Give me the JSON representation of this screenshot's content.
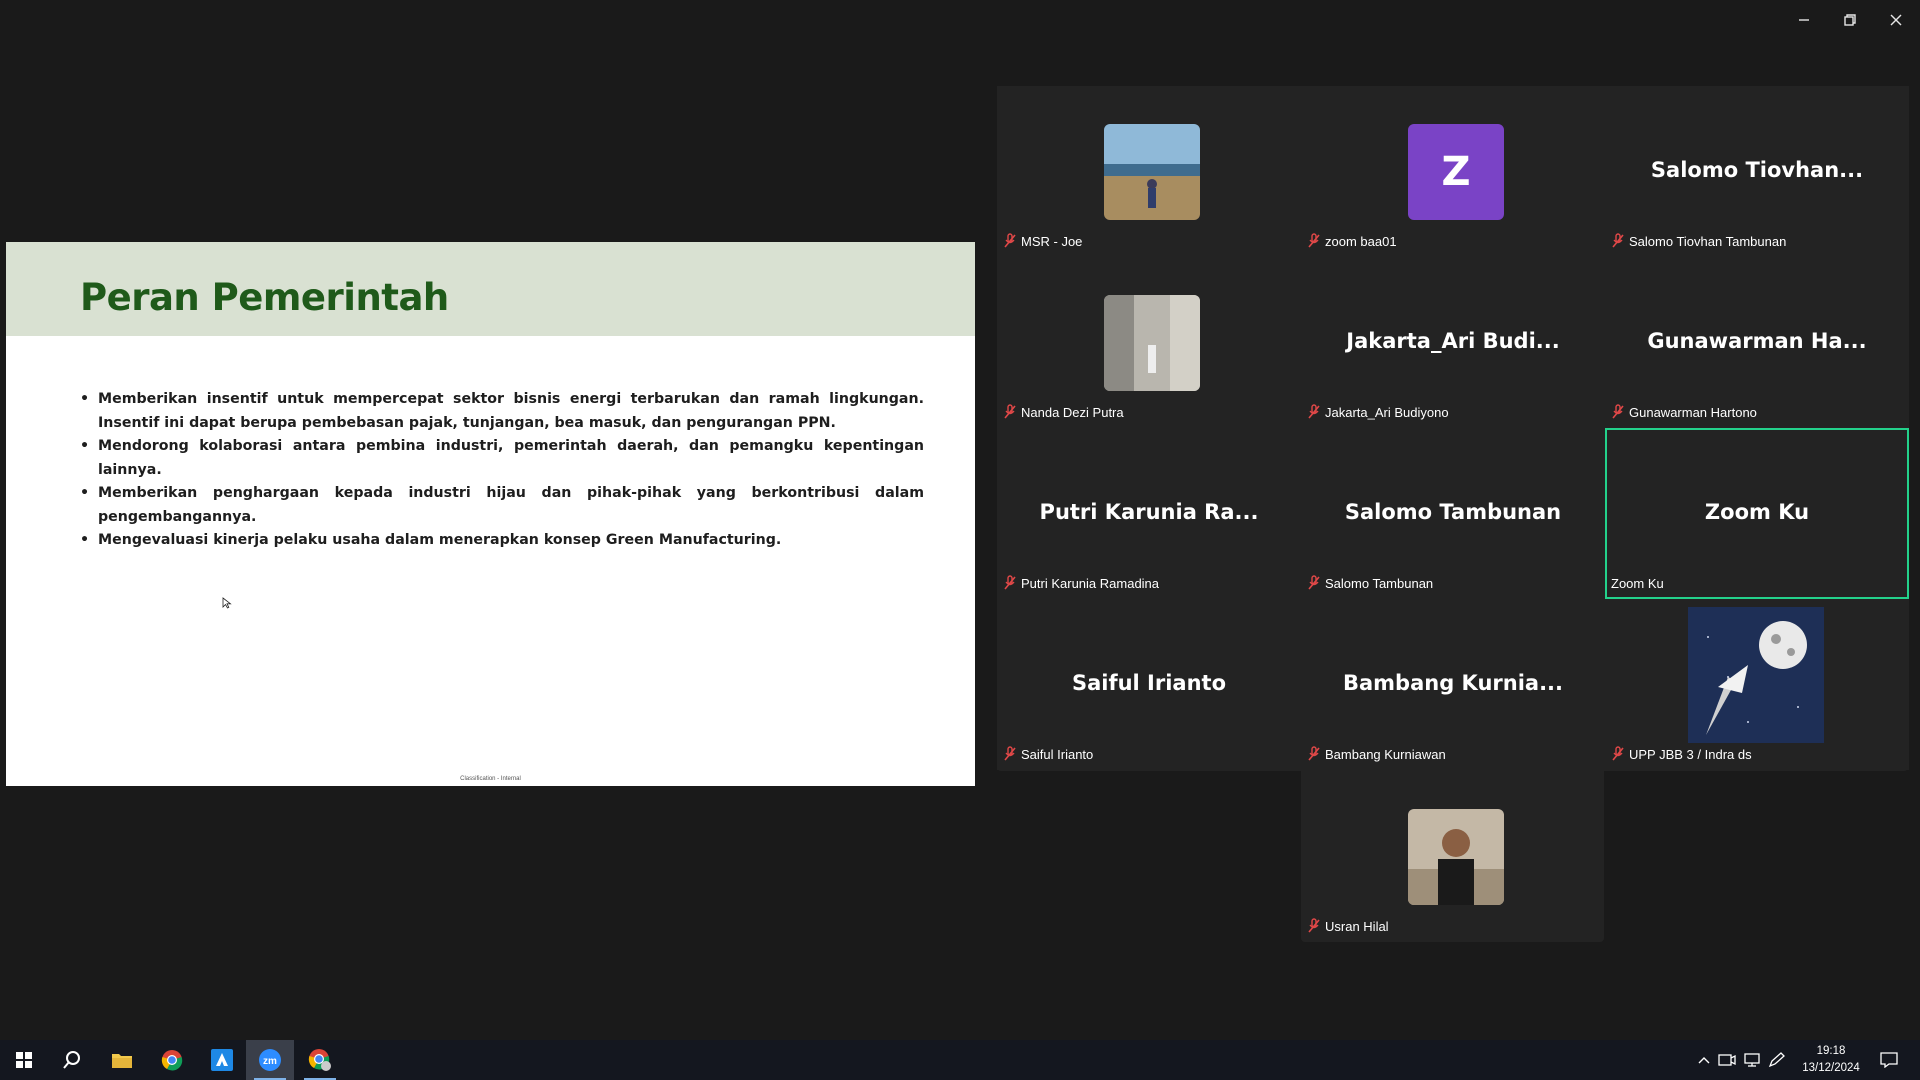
{
  "window": {
    "minimize_label": "Minimize",
    "restore_label": "Restore",
    "close_label": "Close"
  },
  "slide": {
    "title": "Peran Pemerintah",
    "bullets": [
      "Memberikan insentif untuk mempercepat sektor bisnis energi terbarukan dan ramah lingkungan. Insentif ini dapat berupa pembebasan pajak, tunjangan, bea masuk, dan pengurangan PPN.",
      "Mendorong kolaborasi antara pembina industri, pemerintah daerah, dan pemangku kepentingan lainnya.",
      "Memberikan penghargaan kepada industri hijau dan pihak-pihak yang berkontribusi dalam pengembangannya.",
      "Mengevaluasi kinerja pelaku usaha dalam menerapkan konsep Green Manufacturing."
    ],
    "footer": "Classification - Internal"
  },
  "participants": [
    {
      "display": "",
      "label": "MSR - Joe",
      "muted": true,
      "avatar": "photo-coast"
    },
    {
      "display": "Z",
      "label": "zoom baa01",
      "muted": true,
      "avatar": "letter"
    },
    {
      "display": "Salomo  Tiovhan...",
      "label": "Salomo Tiovhan Tambunan",
      "muted": true
    },
    {
      "display": "",
      "label": "Nanda Dezi Putra",
      "muted": true,
      "avatar": "photo-wall"
    },
    {
      "display": "Jakarta_Ari  Budi...",
      "label": "Jakarta_Ari Budiyono",
      "muted": true
    },
    {
      "display": "Gunawarman  Ha...",
      "label": "Gunawarman Hartono",
      "muted": true
    },
    {
      "display": "Putri  Karunia  Ra...",
      "label": "Putri Karunia Ramadina",
      "muted": true
    },
    {
      "display": "Salomo  Tambunan",
      "label": "Salomo Tambunan",
      "muted": true
    },
    {
      "display": "Zoom  Ku",
      "label": "Zoom Ku",
      "muted": false,
      "active_speaker": true
    },
    {
      "display": "Saiful  Irianto",
      "label": "Saiful Irianto",
      "muted": true
    },
    {
      "display": "Bambang  Kurnia...",
      "label": "Bambang Kurniawan",
      "muted": true
    },
    {
      "display": "",
      "label": "UPP JBB 3 / Indra ds",
      "muted": true,
      "avatar": "photo-moon"
    },
    {
      "display": "",
      "label": "Usran Hilal",
      "muted": true,
      "avatar": "photo-person"
    }
  ],
  "taskbar": {
    "apps": [
      "start-icon",
      "search-icon",
      "file-explorer-icon",
      "chrome-icon",
      "azure-icon",
      "zoom-icon",
      "chrome-profile-icon"
    ],
    "clock_time": "19:18",
    "clock_date": "13/12/2024"
  },
  "colors": {
    "slide_title": "#1f5a1a",
    "slide_header_bg": "#d9e1d2",
    "active_speaker_border": "#23d18b",
    "avatar_letter_bg": "#7a43c6",
    "muted_icon": "#e04848"
  }
}
